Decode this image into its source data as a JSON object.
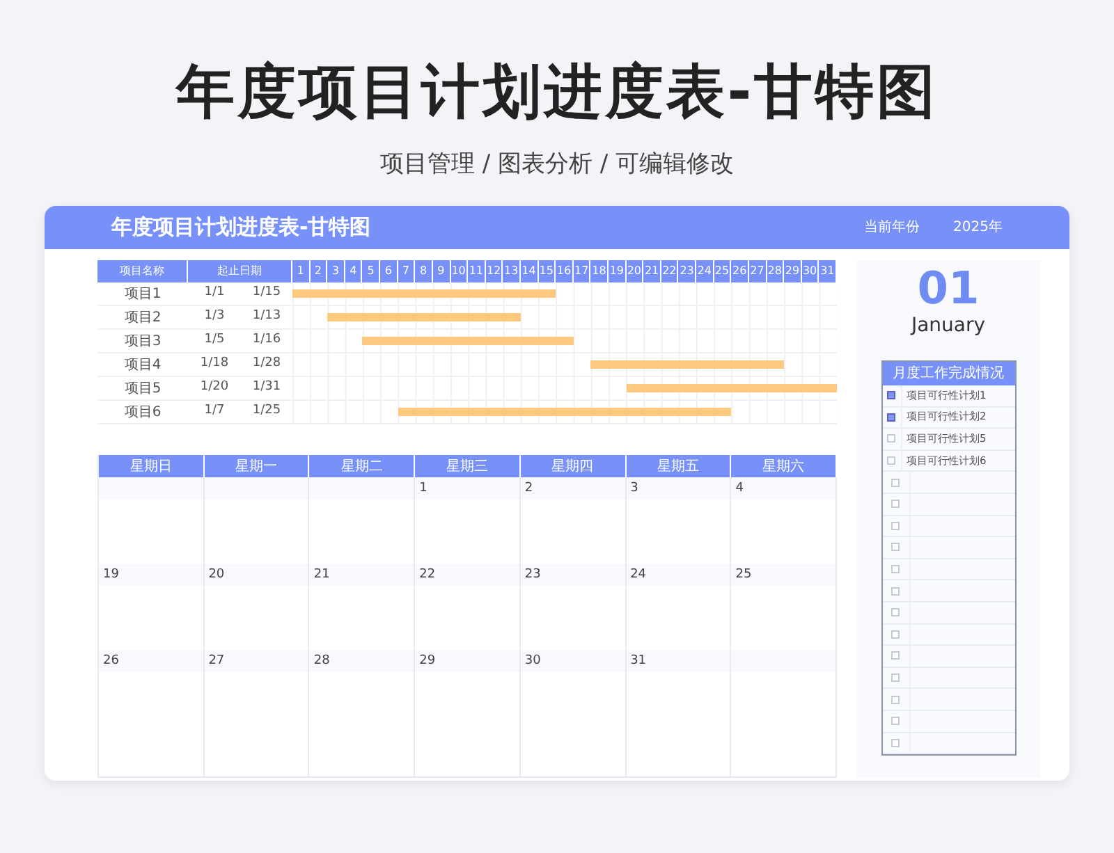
{
  "banner": {
    "title": "年度项目计划进度表-甘特图",
    "subtitle": "项目管理 / 图表分析 / 可编辑修改"
  },
  "sheet": {
    "title": "年度项目计划进度表-甘特图",
    "year_label": "当前年份",
    "year": "2025年"
  },
  "gantt": {
    "columns": [
      "项目名称",
      "起止日期"
    ],
    "days": [
      "1",
      "2",
      "3",
      "4",
      "5",
      "6",
      "7",
      "8",
      "9",
      "10",
      "11",
      "12",
      "13",
      "14",
      "15",
      "16",
      "17",
      "18",
      "19",
      "20",
      "21",
      "22",
      "23",
      "24",
      "25",
      "26",
      "27",
      "28",
      "29",
      "30",
      "31"
    ],
    "rows": [
      {
        "name": "项目1",
        "start": "1/1",
        "end": "1/15"
      },
      {
        "name": "项目2",
        "start": "1/3",
        "end": "1/13"
      },
      {
        "name": "项目3",
        "start": "1/5",
        "end": "1/16"
      },
      {
        "name": "项目4",
        "start": "1/18",
        "end": "1/28"
      },
      {
        "name": "项目5",
        "start": "1/20",
        "end": "1/31"
      },
      {
        "name": "项目6",
        "start": "1/7",
        "end": "1/25"
      }
    ]
  },
  "calendar": {
    "weekdays": [
      "星期日",
      "星期一",
      "星期二",
      "星期三",
      "星期四",
      "星期五",
      "星期六"
    ],
    "weeks": [
      [
        {
          "kind": "blank"
        },
        {
          "kind": "blank"
        },
        {
          "kind": "blank"
        },
        {
          "kind": "day",
          "date": "1"
        },
        {
          "kind": "day",
          "date": "2"
        },
        {
          "kind": "day",
          "date": "3"
        },
        {
          "kind": "day",
          "date": "4"
        }
      ],
      [
        {
          "kind": "day",
          "date": "19"
        },
        {
          "kind": "day",
          "date": "20"
        },
        {
          "kind": "day",
          "date": "21"
        },
        {
          "kind": "day",
          "date": "22"
        },
        {
          "kind": "day",
          "date": "23"
        },
        {
          "kind": "day",
          "date": "24"
        },
        {
          "kind": "day",
          "date": "25"
        }
      ],
      [
        {
          "kind": "day",
          "date": "26"
        },
        {
          "kind": "day",
          "date": "27"
        },
        {
          "kind": "day",
          "date": "28"
        },
        {
          "kind": "day",
          "date": "29"
        },
        {
          "kind": "day",
          "date": "30"
        },
        {
          "kind": "day",
          "date": "31"
        },
        {
          "kind": "blank"
        }
      ]
    ]
  },
  "month": {
    "number": "01",
    "name": "January"
  },
  "checklist": {
    "title": "月度工作完成情况",
    "items": [
      {
        "label": "项目可行性计划1",
        "checked": true
      },
      {
        "label": "项目可行性计划2",
        "checked": true
      },
      {
        "label": "项目可行性计划5",
        "checked": false
      },
      {
        "label": "项目可行性计划6",
        "checked": false
      },
      {
        "checked": false
      },
      {
        "checked": false
      },
      {
        "checked": false
      },
      {
        "checked": false
      },
      {
        "checked": false
      },
      {
        "checked": false
      },
      {
        "checked": false
      },
      {
        "checked": false
      },
      {
        "checked": false
      },
      {
        "checked": false
      },
      {
        "checked": false
      },
      {
        "checked": false
      },
      {
        "checked": false
      }
    ]
  }
}
